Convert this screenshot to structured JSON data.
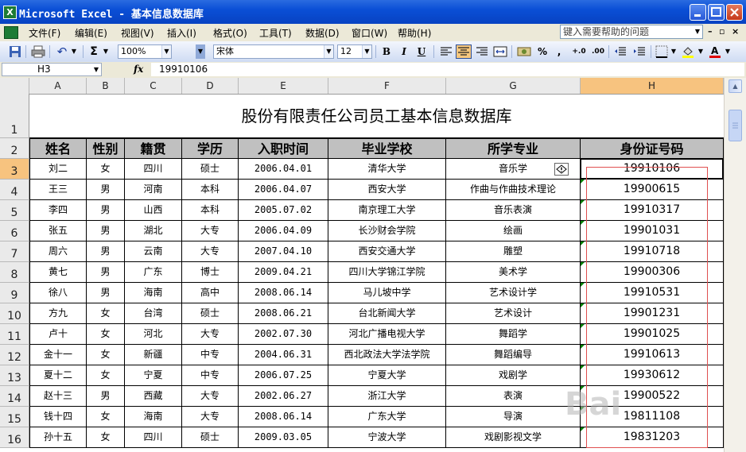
{
  "window": {
    "title": "Microsoft Excel - 基本信息数据库",
    "app_icon": "excel-icon",
    "accent": "#0a4fd6"
  },
  "menu": {
    "items": [
      "文件(F)",
      "编辑(E)",
      "视图(V)",
      "插入(I)",
      "格式(O)",
      "工具(T)",
      "数据(D)",
      "窗口(W)",
      "帮助(H)"
    ],
    "help_placeholder": "键入需要帮助的问题"
  },
  "toolbar": {
    "zoom": "100%",
    "font_name": "宋体",
    "font_size": "12",
    "bold": "B",
    "italic": "I",
    "underline": "U",
    "percent": "%",
    "comma": ",",
    "sigma": "Σ"
  },
  "formula_bar": {
    "name_box": "H3",
    "fx": "fx",
    "formula": "19910106"
  },
  "sheet": {
    "columns": [
      "A",
      "B",
      "C",
      "D",
      "E",
      "F",
      "G",
      "H"
    ],
    "active_column": "H",
    "active_row": 3,
    "row_numbers": [
      "1",
      "2",
      "3",
      "4",
      "5",
      "6",
      "7",
      "8",
      "9",
      "10",
      "11",
      "12",
      "13",
      "14",
      "15",
      "16"
    ],
    "title": "股份有限责任公司员工基本信息数据库",
    "headers": [
      "姓名",
      "性别",
      "籍贯",
      "学历",
      "入职时间",
      "毕业学校",
      "所学专业",
      "身份证号码"
    ],
    "rows": [
      [
        "刘二",
        "女",
        "四川",
        "硕士",
        "2006.04.01",
        "清华大学",
        "音乐学",
        "19910106"
      ],
      [
        "王三",
        "男",
        "河南",
        "本科",
        "2006.04.07",
        "西安大学",
        "作曲与作曲技术理论",
        "19900615"
      ],
      [
        "李四",
        "男",
        "山西",
        "本科",
        "2005.07.02",
        "南京理工大学",
        "音乐表演",
        "19910317"
      ],
      [
        "张五",
        "男",
        "湖北",
        "大专",
        "2006.04.09",
        "长沙财会学院",
        "绘画",
        "19901031"
      ],
      [
        "周六",
        "男",
        "云南",
        "大专",
        "2007.04.10",
        "西安交通大学",
        "雕塑",
        "19910718"
      ],
      [
        "黄七",
        "男",
        "广东",
        "博士",
        "2009.04.21",
        "四川大学锦江学院",
        "美术学",
        "19900306"
      ],
      [
        "徐八",
        "男",
        "海南",
        "高中",
        "2008.06.14",
        "马儿坡中学",
        "艺术设计学",
        "19910531"
      ],
      [
        "方九",
        "女",
        "台湾",
        "硕士",
        "2008.06.21",
        "台北新闻大学",
        "艺术设计",
        "19901231"
      ],
      [
        "卢十",
        "女",
        "河北",
        "大专",
        "2002.07.30",
        "河北广播电视大学",
        "舞蹈学",
        "19901025"
      ],
      [
        "金十一",
        "女",
        "新疆",
        "中专",
        "2004.06.31",
        "西北政法大学法学院",
        "舞蹈编导",
        "19910613"
      ],
      [
        "夏十二",
        "女",
        "宁夏",
        "中专",
        "2006.07.25",
        "宁夏大学",
        "戏剧学",
        "19930612"
      ],
      [
        "赵十三",
        "男",
        "西藏",
        "大专",
        "2002.06.27",
        "浙江大学",
        "表演",
        "19900522"
      ],
      [
        "钱十四",
        "女",
        "海南",
        "大专",
        "2008.06.14",
        "广东大学",
        "导演",
        "19811108"
      ],
      [
        "孙十五",
        "女",
        "四川",
        "硕士",
        "2009.03.05",
        "宁波大学",
        "戏剧影视文学",
        "19831203"
      ]
    ]
  }
}
